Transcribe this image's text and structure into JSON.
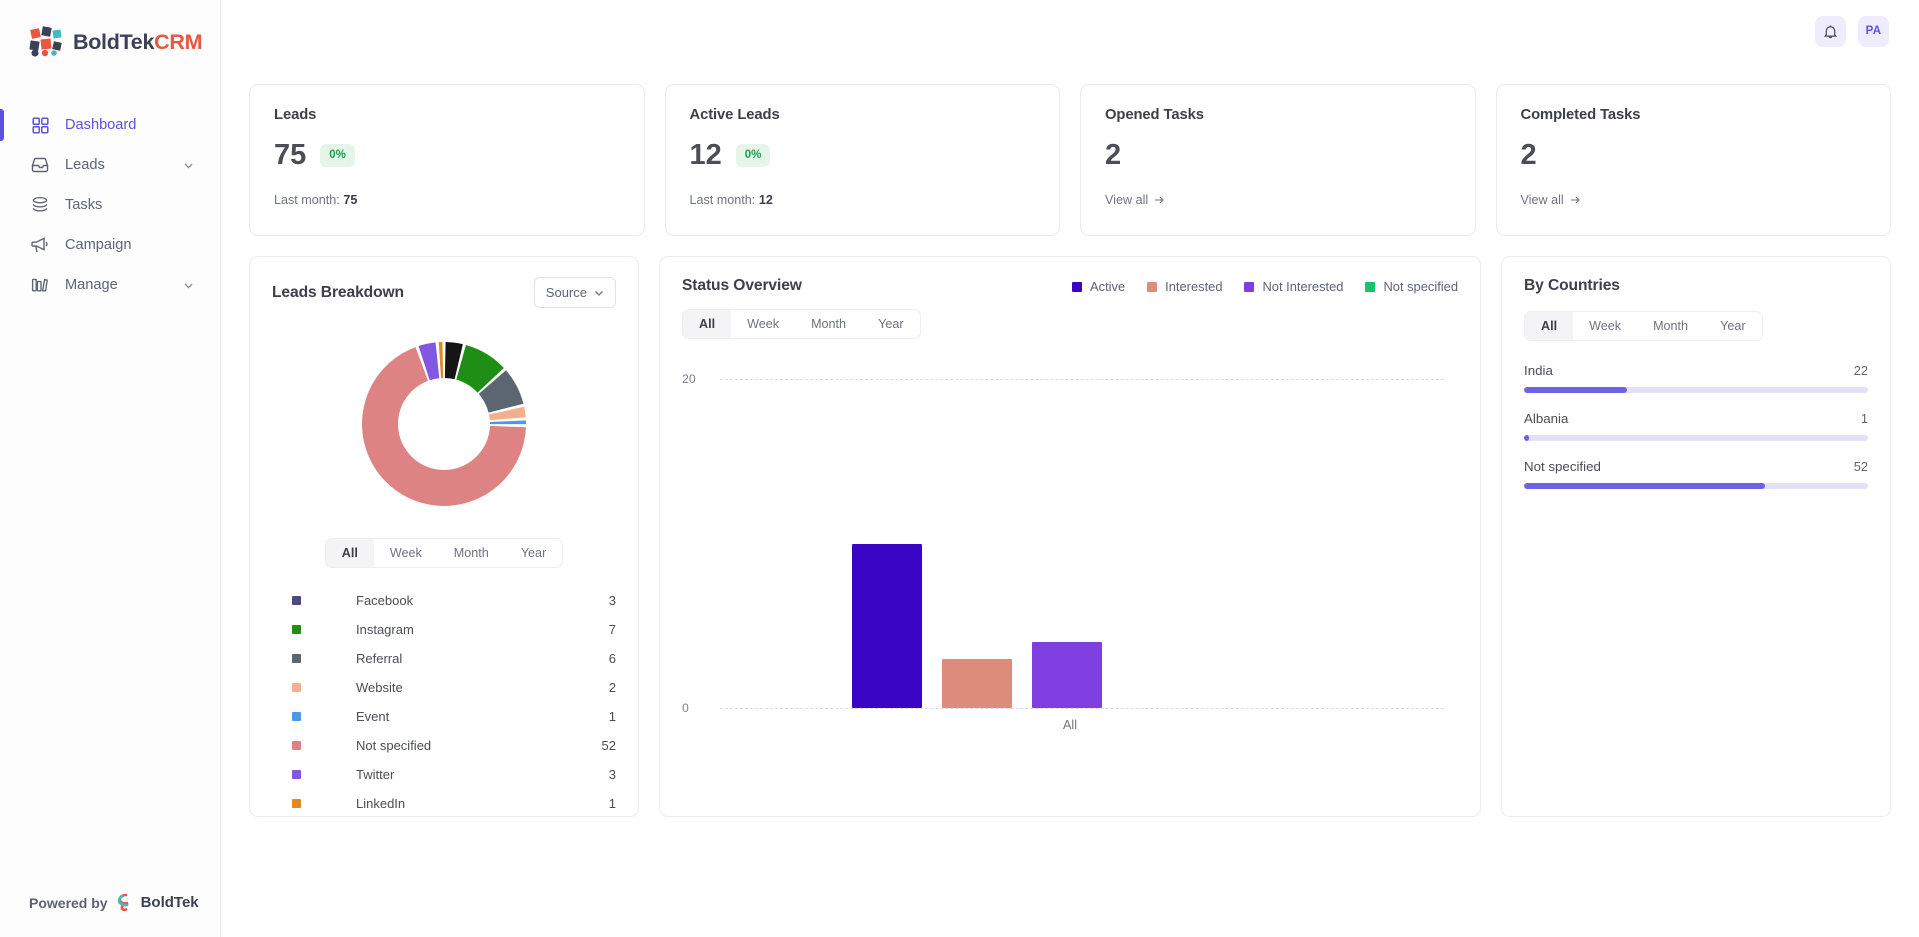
{
  "brand": {
    "name_bold": "BoldTek",
    "name_accent": "CRM"
  },
  "sidebar": {
    "items": [
      {
        "label": "Dashboard",
        "icon": "grid-icon",
        "active": true,
        "chevron": false
      },
      {
        "label": "Leads",
        "icon": "inbox-icon",
        "active": false,
        "chevron": true
      },
      {
        "label": "Tasks",
        "icon": "layers-icon",
        "active": false,
        "chevron": false
      },
      {
        "label": "Campaign",
        "icon": "megaphone-icon",
        "active": false,
        "chevron": false
      },
      {
        "label": "Manage",
        "icon": "buildings-icon",
        "active": false,
        "chevron": true
      }
    ],
    "footer": {
      "powered_label": "Powered by",
      "brand": "BoldTek"
    }
  },
  "topbar": {
    "notification_icon": "bell-icon",
    "avatar_initials": "PA"
  },
  "kpis": [
    {
      "title": "Leads",
      "value": "75",
      "badge": "0%",
      "foot_label": "Last month:",
      "foot_value": "75",
      "link": null
    },
    {
      "title": "Active Leads",
      "value": "12",
      "badge": "0%",
      "foot_label": "Last month:",
      "foot_value": "12",
      "link": null
    },
    {
      "title": "Opened Tasks",
      "value": "2",
      "badge": null,
      "foot_label": null,
      "foot_value": null,
      "link": "View all"
    },
    {
      "title": "Completed Tasks",
      "value": "2",
      "badge": null,
      "foot_label": null,
      "foot_value": null,
      "link": "View all"
    }
  ],
  "breakdown": {
    "title": "Leads Breakdown",
    "selector": "Source",
    "range_tabs": [
      "All",
      "Week",
      "Month",
      "Year"
    ],
    "active_range": "All",
    "chart_data": {
      "type": "pie",
      "title": "Leads Breakdown",
      "categories": [
        "Facebook",
        "Instagram",
        "Referral",
        "Website",
        "Event",
        "Not specified",
        "Twitter",
        "LinkedIn"
      ],
      "values": [
        3,
        7,
        6,
        2,
        1,
        52,
        3,
        1
      ],
      "colors": [
        "#151515",
        "#1e8f14",
        "#5b6670",
        "#f2b18c",
        "#4f97e8",
        "#dd8383",
        "#8358e0",
        "#e08a1e"
      ],
      "legend_swatch_colors": [
        "#4a4a88",
        "#1e8f14",
        "#5b6670",
        "#f2b18c",
        "#4f97e8",
        "#dd8383",
        "#8358e0",
        "#e08a1e"
      ],
      "legend_position": "bottom",
      "donut": true
    }
  },
  "status": {
    "title": "Status Overview",
    "range_tabs": [
      "All",
      "Week",
      "Month",
      "Year"
    ],
    "active_range": "All",
    "legend": [
      {
        "label": "Active",
        "color": "#3a04c4"
      },
      {
        "label": "Interested",
        "color": "#dd8b7a"
      },
      {
        "label": "Not Interested",
        "color": "#7f3fe0"
      },
      {
        "label": "Not specified",
        "color": "#14c66a"
      }
    ],
    "chart_data": {
      "type": "bar",
      "title": "Status Overview",
      "categories": [
        "All"
      ],
      "series": [
        {
          "name": "Active",
          "values": [
            10
          ],
          "color": "#3a04c4"
        },
        {
          "name": "Interested",
          "values": [
            3
          ],
          "color": "#dd8b7a"
        },
        {
          "name": "Not Interested",
          "values": [
            4
          ],
          "color": "#7f3fe0"
        },
        {
          "name": "Not specified",
          "values": [
            0
          ],
          "color": "#14c66a"
        }
      ],
      "xlabel": "",
      "ylabel": "",
      "ylim": [
        0,
        20
      ],
      "yticks": [
        0,
        20
      ],
      "grid": true,
      "legend_position": "top-right"
    }
  },
  "countries": {
    "title": "By Countries",
    "range_tabs": [
      "All",
      "Week",
      "Month",
      "Year"
    ],
    "active_range": "All",
    "chart_data": {
      "type": "bar",
      "title": "By Countries",
      "categories": [
        "India",
        "Albania",
        "Not specified"
      ],
      "values": [
        22,
        1,
        52
      ],
      "percents": [
        30,
        1.5,
        70
      ],
      "bar_color": "#6e63e3",
      "track_color": "#e3e1f8",
      "orientation": "horizontal"
    }
  }
}
